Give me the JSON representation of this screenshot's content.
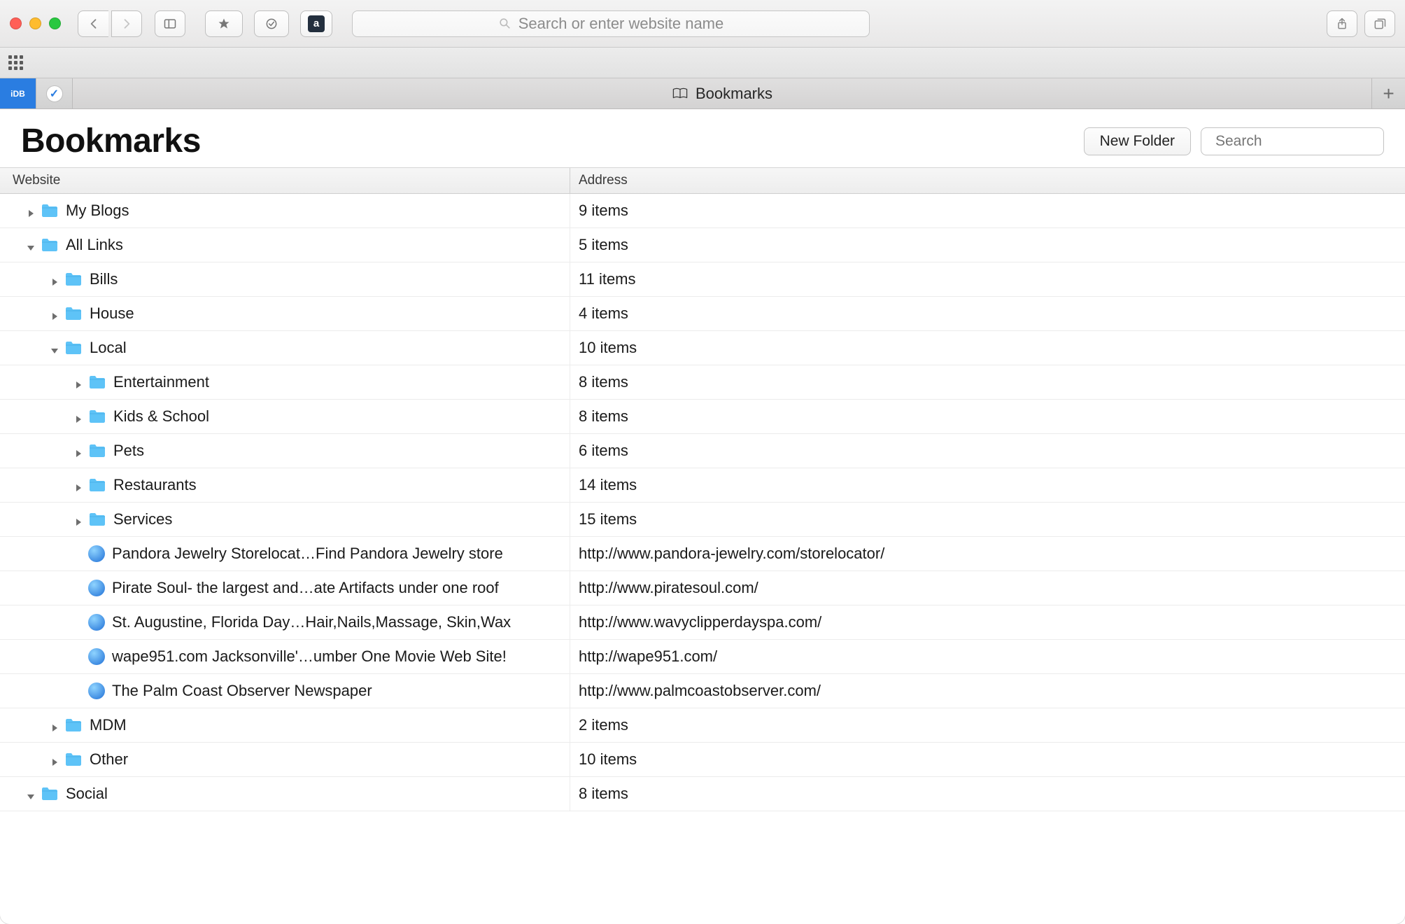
{
  "toolbar": {
    "url_placeholder": "Search or enter website name",
    "idb_label": "iDB"
  },
  "tab": {
    "title": "Bookmarks"
  },
  "page": {
    "title": "Bookmarks",
    "new_folder_label": "New Folder",
    "search_placeholder": "Search"
  },
  "columns": {
    "website": "Website",
    "address": "Address"
  },
  "rows": [
    {
      "indent": 0,
      "type": "folder",
      "expanded": false,
      "name": "My Blogs",
      "addr": "9 items"
    },
    {
      "indent": 0,
      "type": "folder",
      "expanded": true,
      "name": "All Links",
      "addr": "5 items"
    },
    {
      "indent": 1,
      "type": "folder",
      "expanded": false,
      "name": "Bills",
      "addr": "11 items"
    },
    {
      "indent": 1,
      "type": "folder",
      "expanded": false,
      "name": "House",
      "addr": "4 items"
    },
    {
      "indent": 1,
      "type": "folder",
      "expanded": true,
      "name": "Local",
      "addr": "10 items"
    },
    {
      "indent": 2,
      "type": "folder",
      "expanded": false,
      "name": "Entertainment",
      "addr": "8 items"
    },
    {
      "indent": 2,
      "type": "folder",
      "expanded": false,
      "name": "Kids & School",
      "addr": "8 items"
    },
    {
      "indent": 2,
      "type": "folder",
      "expanded": false,
      "name": "Pets",
      "addr": "6 items"
    },
    {
      "indent": 2,
      "type": "folder",
      "expanded": false,
      "name": "Restaurants",
      "addr": "14 items"
    },
    {
      "indent": 2,
      "type": "folder",
      "expanded": false,
      "name": "Services",
      "addr": "15 items"
    },
    {
      "indent": 2,
      "type": "bookmark",
      "name": "Pandora Jewelry Storelocat…Find Pandora Jewelry store",
      "addr": "http://www.pandora-jewelry.com/storelocator/"
    },
    {
      "indent": 2,
      "type": "bookmark",
      "name": "Pirate Soul- the largest and…ate Artifacts under one roof",
      "addr": "http://www.piratesoul.com/"
    },
    {
      "indent": 2,
      "type": "bookmark",
      "name": "St. Augustine, Florida Day…Hair,Nails,Massage, Skin,Wax",
      "addr": "http://www.wavyclipperdayspa.com/"
    },
    {
      "indent": 2,
      "type": "bookmark",
      "name": "wape951.com Jacksonville'…umber One Movie Web Site!",
      "addr": "http://wape951.com/"
    },
    {
      "indent": 2,
      "type": "bookmark",
      "name": "The Palm Coast Observer Newspaper",
      "addr": "http://www.palmcoastobserver.com/"
    },
    {
      "indent": 1,
      "type": "folder",
      "expanded": false,
      "name": "MDM",
      "addr": "2 items"
    },
    {
      "indent": 1,
      "type": "folder",
      "expanded": false,
      "name": "Other",
      "addr": "10 items"
    },
    {
      "indent": 0,
      "type": "folder",
      "expanded": true,
      "name": "Social",
      "addr": "8 items"
    }
  ]
}
